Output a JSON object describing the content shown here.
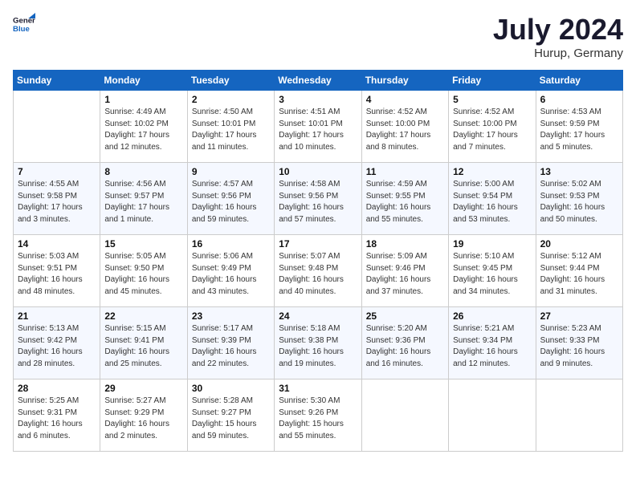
{
  "header": {
    "logo_line1": "General",
    "logo_line2": "Blue",
    "month": "July 2024",
    "location": "Hurup, Germany"
  },
  "days_of_week": [
    "Sunday",
    "Monday",
    "Tuesday",
    "Wednesday",
    "Thursday",
    "Friday",
    "Saturday"
  ],
  "weeks": [
    [
      {
        "day": "",
        "info": ""
      },
      {
        "day": "1",
        "info": "Sunrise: 4:49 AM\nSunset: 10:02 PM\nDaylight: 17 hours\nand 12 minutes."
      },
      {
        "day": "2",
        "info": "Sunrise: 4:50 AM\nSunset: 10:01 PM\nDaylight: 17 hours\nand 11 minutes."
      },
      {
        "day": "3",
        "info": "Sunrise: 4:51 AM\nSunset: 10:01 PM\nDaylight: 17 hours\nand 10 minutes."
      },
      {
        "day": "4",
        "info": "Sunrise: 4:52 AM\nSunset: 10:00 PM\nDaylight: 17 hours\nand 8 minutes."
      },
      {
        "day": "5",
        "info": "Sunrise: 4:52 AM\nSunset: 10:00 PM\nDaylight: 17 hours\nand 7 minutes."
      },
      {
        "day": "6",
        "info": "Sunrise: 4:53 AM\nSunset: 9:59 PM\nDaylight: 17 hours\nand 5 minutes."
      }
    ],
    [
      {
        "day": "7",
        "info": "Sunrise: 4:55 AM\nSunset: 9:58 PM\nDaylight: 17 hours\nand 3 minutes."
      },
      {
        "day": "8",
        "info": "Sunrise: 4:56 AM\nSunset: 9:57 PM\nDaylight: 17 hours\nand 1 minute."
      },
      {
        "day": "9",
        "info": "Sunrise: 4:57 AM\nSunset: 9:56 PM\nDaylight: 16 hours\nand 59 minutes."
      },
      {
        "day": "10",
        "info": "Sunrise: 4:58 AM\nSunset: 9:56 PM\nDaylight: 16 hours\nand 57 minutes."
      },
      {
        "day": "11",
        "info": "Sunrise: 4:59 AM\nSunset: 9:55 PM\nDaylight: 16 hours\nand 55 minutes."
      },
      {
        "day": "12",
        "info": "Sunrise: 5:00 AM\nSunset: 9:54 PM\nDaylight: 16 hours\nand 53 minutes."
      },
      {
        "day": "13",
        "info": "Sunrise: 5:02 AM\nSunset: 9:53 PM\nDaylight: 16 hours\nand 50 minutes."
      }
    ],
    [
      {
        "day": "14",
        "info": "Sunrise: 5:03 AM\nSunset: 9:51 PM\nDaylight: 16 hours\nand 48 minutes."
      },
      {
        "day": "15",
        "info": "Sunrise: 5:05 AM\nSunset: 9:50 PM\nDaylight: 16 hours\nand 45 minutes."
      },
      {
        "day": "16",
        "info": "Sunrise: 5:06 AM\nSunset: 9:49 PM\nDaylight: 16 hours\nand 43 minutes."
      },
      {
        "day": "17",
        "info": "Sunrise: 5:07 AM\nSunset: 9:48 PM\nDaylight: 16 hours\nand 40 minutes."
      },
      {
        "day": "18",
        "info": "Sunrise: 5:09 AM\nSunset: 9:46 PM\nDaylight: 16 hours\nand 37 minutes."
      },
      {
        "day": "19",
        "info": "Sunrise: 5:10 AM\nSunset: 9:45 PM\nDaylight: 16 hours\nand 34 minutes."
      },
      {
        "day": "20",
        "info": "Sunrise: 5:12 AM\nSunset: 9:44 PM\nDaylight: 16 hours\nand 31 minutes."
      }
    ],
    [
      {
        "day": "21",
        "info": "Sunrise: 5:13 AM\nSunset: 9:42 PM\nDaylight: 16 hours\nand 28 minutes."
      },
      {
        "day": "22",
        "info": "Sunrise: 5:15 AM\nSunset: 9:41 PM\nDaylight: 16 hours\nand 25 minutes."
      },
      {
        "day": "23",
        "info": "Sunrise: 5:17 AM\nSunset: 9:39 PM\nDaylight: 16 hours\nand 22 minutes."
      },
      {
        "day": "24",
        "info": "Sunrise: 5:18 AM\nSunset: 9:38 PM\nDaylight: 16 hours\nand 19 minutes."
      },
      {
        "day": "25",
        "info": "Sunrise: 5:20 AM\nSunset: 9:36 PM\nDaylight: 16 hours\nand 16 minutes."
      },
      {
        "day": "26",
        "info": "Sunrise: 5:21 AM\nSunset: 9:34 PM\nDaylight: 16 hours\nand 12 minutes."
      },
      {
        "day": "27",
        "info": "Sunrise: 5:23 AM\nSunset: 9:33 PM\nDaylight: 16 hours\nand 9 minutes."
      }
    ],
    [
      {
        "day": "28",
        "info": "Sunrise: 5:25 AM\nSunset: 9:31 PM\nDaylight: 16 hours\nand 6 minutes."
      },
      {
        "day": "29",
        "info": "Sunrise: 5:27 AM\nSunset: 9:29 PM\nDaylight: 16 hours\nand 2 minutes."
      },
      {
        "day": "30",
        "info": "Sunrise: 5:28 AM\nSunset: 9:27 PM\nDaylight: 15 hours\nand 59 minutes."
      },
      {
        "day": "31",
        "info": "Sunrise: 5:30 AM\nSunset: 9:26 PM\nDaylight: 15 hours\nand 55 minutes."
      },
      {
        "day": "",
        "info": ""
      },
      {
        "day": "",
        "info": ""
      },
      {
        "day": "",
        "info": ""
      }
    ]
  ]
}
